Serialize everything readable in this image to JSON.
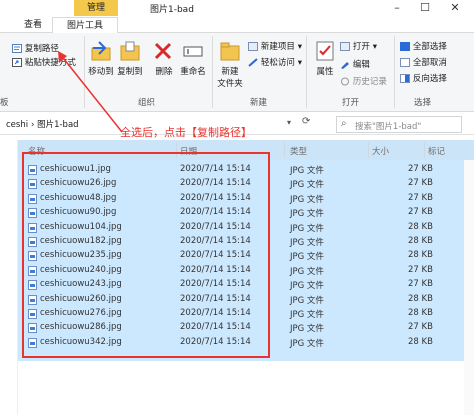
{
  "title_bar": {
    "manage_tab": "管理",
    "title": "图片1-bad"
  },
  "tabs": [
    {
      "label": "查看"
    },
    {
      "label": "图片工具"
    }
  ],
  "ribbon": {
    "clipboard": {
      "copy_path": "复制路径",
      "paste_shortcut": "粘贴快捷方式"
    },
    "organize": {
      "move_to": "移动到",
      "copy_to": "复制到",
      "delete": "删除",
      "rename": "重命名",
      "group_label": "组织"
    },
    "new": {
      "new_folder": "新建\n文件夹",
      "new_folder_line1": "新建",
      "new_folder_line2": "文件夹",
      "new_item": "新建项目",
      "easy_access": "轻松访问",
      "group_label": "新建"
    },
    "open": {
      "properties": "属性",
      "open": "打开",
      "edit": "编辑",
      "history": "历史记录",
      "group_label": "打开"
    },
    "select": {
      "select_all": "全部选择",
      "select_none": "全部取消",
      "invert": "反向选择",
      "group_label": "选择"
    },
    "left_group_label": "板"
  },
  "address": {
    "crumb1": "ceshi",
    "crumb2": "图片1-bad",
    "search_placeholder": "搜索\"图片1-bad\""
  },
  "annotation": "全选后，点击【复制路径】",
  "columns": {
    "name": "名称",
    "date": "日期",
    "type": "类型",
    "size": "大小",
    "tags": "标记"
  },
  "files": [
    {
      "name": "ceshicuowu1.jpg",
      "date": "2020/7/14 15:14",
      "type": "JPG 文件",
      "size": "27 KB"
    },
    {
      "name": "ceshicuowu26.jpg",
      "date": "2020/7/14 15:14",
      "type": "JPG 文件",
      "size": "27 KB"
    },
    {
      "name": "ceshicuowu48.jpg",
      "date": "2020/7/14 15:14",
      "type": "JPG 文件",
      "size": "27 KB"
    },
    {
      "name": "ceshicuowu90.jpg",
      "date": "2020/7/14 15:14",
      "type": "JPG 文件",
      "size": "27 KB"
    },
    {
      "name": "ceshicuowu104.jpg",
      "date": "2020/7/14 15:14",
      "type": "JPG 文件",
      "size": "28 KB"
    },
    {
      "name": "ceshicuowu182.jpg",
      "date": "2020/7/14 15:14",
      "type": "JPG 文件",
      "size": "28 KB"
    },
    {
      "name": "ceshicuowu235.jpg",
      "date": "2020/7/14 15:14",
      "type": "JPG 文件",
      "size": "28 KB"
    },
    {
      "name": "ceshicuowu240.jpg",
      "date": "2020/7/14 15:14",
      "type": "JPG 文件",
      "size": "27 KB"
    },
    {
      "name": "ceshicuowu243.jpg",
      "date": "2020/7/14 15:14",
      "type": "JPG 文件",
      "size": "27 KB"
    },
    {
      "name": "ceshicuowu260.jpg",
      "date": "2020/7/14 15:14",
      "type": "JPG 文件",
      "size": "28 KB"
    },
    {
      "name": "ceshicuowu276.jpg",
      "date": "2020/7/14 15:14",
      "type": "JPG 文件",
      "size": "28 KB"
    },
    {
      "name": "ceshicuowu286.jpg",
      "date": "2020/7/14 15:14",
      "type": "JPG 文件",
      "size": "27 KB"
    },
    {
      "name": "ceshicuowu342.jpg",
      "date": "2020/7/14 15:14",
      "type": "JPG 文件",
      "size": "28 KB"
    }
  ],
  "colors": {
    "manage_tab": "#f4c84a",
    "selection": "#cce8ff",
    "annotation": "#e8332f",
    "header": "#cce4f7"
  }
}
